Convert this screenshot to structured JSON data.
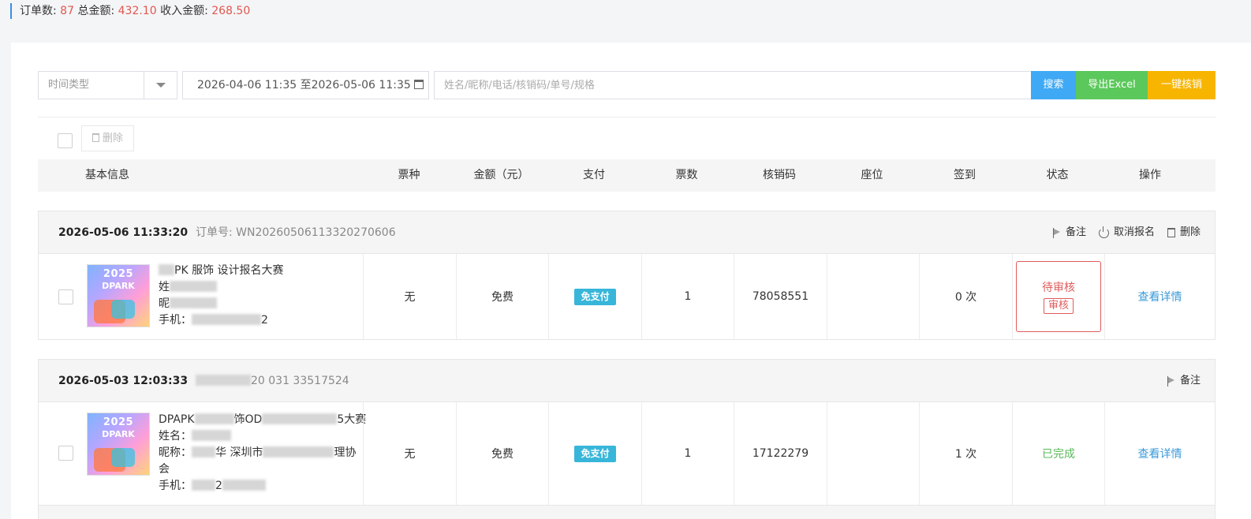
{
  "summary": {
    "orders_label": "订单数:",
    "orders": "87",
    "total_label": "总金额:",
    "total": "432.10",
    "income_label": "收入金额:",
    "income": "268.50"
  },
  "filters": {
    "time_type": "时间类型",
    "date_range": "2026-04-06 11:35 至2026-05-06 11:35",
    "search_placeholder": "姓名/昵称/电话/核销码/单号/规格"
  },
  "buttons": {
    "search": "搜索",
    "export": "导出Excel",
    "verify_all": "一键核销",
    "bulk_delete": "删除"
  },
  "columns": [
    "基本信息",
    "票种",
    "金额（元）",
    "支付",
    "票数",
    "核销码",
    "座位",
    "签到",
    "状态",
    "操作"
  ],
  "colors": {
    "accent": "#3a8ee6",
    "number": "#e0584e",
    "search": "#3fa9f5",
    "export": "#5bc85b",
    "verify": "#f7b500",
    "pending": "#e05b5b",
    "done": "#5bb85b",
    "link": "#3a9ad9"
  },
  "orders": [
    {
      "time": "2026-05-06 11:33:20",
      "order_no": "订单号: WN20260506113320270606",
      "actions": {
        "remark": "备注",
        "cancel": "取消报名",
        "delete": "删除"
      },
      "poster": {
        "year": "2025",
        "brand": "DPARK"
      },
      "event_name": "PK  服饰  设计报名大赛",
      "name_label": "姓",
      "nick_label": "昵",
      "phone_label": "手机：",
      "phone_tail": "2",
      "ticket_type": "无",
      "amount": "免费",
      "pay": "免支付",
      "count": "1",
      "code": "78058551",
      "seat": "",
      "checkin": "0 次",
      "status": "待审核",
      "status_action": "审核",
      "op": "查看详情"
    },
    {
      "time": "2026-05-03 12:03:33",
      "order_no": "20  031  33517524",
      "actions": {
        "remark": "备注"
      },
      "poster": {
        "year": "2025",
        "brand": "DPARK"
      },
      "event_name_a": "DPAPK",
      "event_name_b": "饰OD",
      "event_name_c": "5大赛",
      "name_label": "姓名：",
      "nick_label": "昵称：",
      "nick_a": "华 深圳市",
      "nick_b": "理协",
      "nick_c": "会",
      "phone_label": "手机：",
      "phone_mid": "2",
      "ticket_type": "无",
      "amount": "免费",
      "pay": "免支付",
      "count": "1",
      "code": "17122279",
      "seat": "",
      "checkin": "1 次",
      "status": "已完成",
      "op": "查看详情"
    }
  ]
}
